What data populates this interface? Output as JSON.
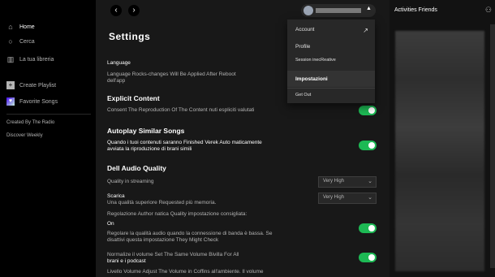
{
  "sidebar": {
    "home": "Home",
    "search": "Cerca",
    "library": "La tua libreria",
    "create_playlist": "Create Playlist",
    "liked_songs": "Favorite Songs",
    "playlists": [
      "Created By The Radio",
      "Discover Weekly"
    ]
  },
  "topbar": {
    "back_icon": "chevron-left-icon",
    "forward_icon": "chevron-right-icon"
  },
  "settings": {
    "title": "Settings",
    "language_label": "Language",
    "language_note": "Language Rocks-changes Will Be Applied After Reboot",
    "language_note2": "dell'app",
    "explicit_heading": "Explicit Content",
    "explicit_desc": "Consent The Reproduction Of The Content nuti espliciti valutati",
    "autoplay_heading": "Autoplay Similar Songs",
    "autoplay_desc1": "Quando i tuoi contenuti saranno Finished Verek Auto maticamente",
    "autoplay_desc2": "avviata la riproduzione di brani simili",
    "audio_heading": "Dell Audio Quality",
    "streaming_label": "Quality in streaming",
    "streaming_value": "Very High",
    "download_label": "Scarica",
    "download_desc": "Una qualità superiore Requested più memoria.",
    "download_value": "Very High",
    "auto_quality_label": "Regolazione Author natica Quality impostazione consigliata:",
    "auto_quality_on": "On",
    "auto_quality_desc": "Regolare la qualità audio quando la connessione di banda è bassa. Se disattivi questa impostazione They Might Check",
    "normalize_label": "Normalize il volume Set The Same Volume Bivilla For All",
    "normalize_desc": "brani e i podcast",
    "volume_label": "Livello Volume Adjust The Volume in Coffins all'ambiente. Il volume"
  },
  "account_menu": {
    "items": [
      "Account",
      "Profile",
      "Session inecReative",
      "Impostazioni",
      "Get Out"
    ],
    "selected": "Impostazioni"
  },
  "friends": {
    "title": "Activities Friends"
  },
  "colors": {
    "accent": "#1db954",
    "background": "#181818",
    "sidebar": "#000000"
  }
}
